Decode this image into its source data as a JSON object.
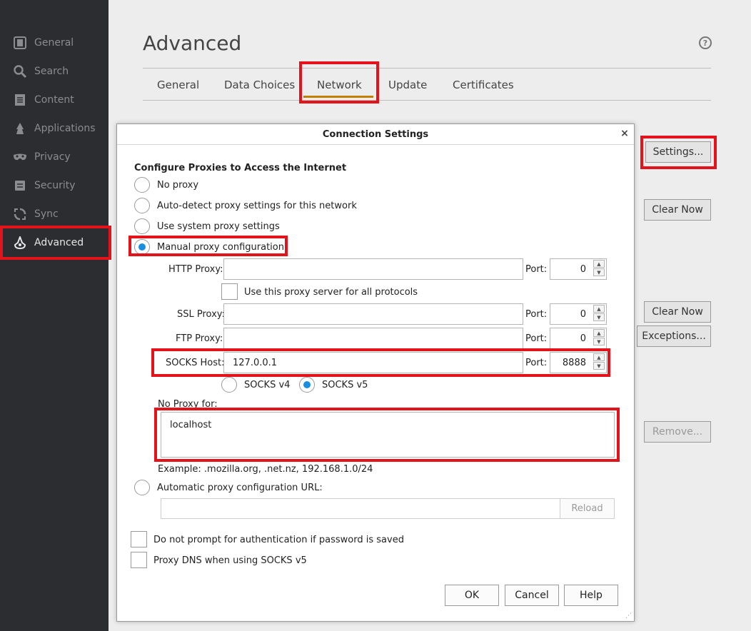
{
  "sidebar": {
    "items": [
      {
        "label": "General",
        "icon": "general-icon"
      },
      {
        "label": "Search",
        "icon": "search-icon"
      },
      {
        "label": "Content",
        "icon": "content-icon"
      },
      {
        "label": "Applications",
        "icon": "applications-icon"
      },
      {
        "label": "Privacy",
        "icon": "privacy-icon"
      },
      {
        "label": "Security",
        "icon": "security-icon"
      },
      {
        "label": "Sync",
        "icon": "sync-icon"
      },
      {
        "label": "Advanced",
        "icon": "advanced-icon",
        "active": true
      }
    ]
  },
  "main": {
    "title": "Advanced",
    "help_icon": "?",
    "tabs": [
      "General",
      "Data Choices",
      "Network",
      "Update",
      "Certificates"
    ],
    "active_tab": "Network",
    "buttons": {
      "settings": "Settings...",
      "clear_now_1": "Clear Now",
      "clear_now_2": "Clear Now",
      "exceptions": "Exceptions...",
      "remove": "Remove..."
    }
  },
  "dialog": {
    "title": "Connection Settings",
    "close": "×",
    "heading": "Configure Proxies to Access the Internet",
    "options": {
      "no_proxy": "No proxy",
      "auto_detect": "Auto-detect proxy settings for this network",
      "system": "Use system proxy settings",
      "manual": "Manual proxy configuration:",
      "auto_url": "Automatic proxy configuration URL:"
    },
    "selected_option": "manual",
    "http_proxy": {
      "label": "HTTP Proxy:",
      "value": "",
      "port_label": "Port:",
      "port": "0"
    },
    "use_for_all": "Use this proxy server for all protocols",
    "ssl_proxy": {
      "label": "SSL Proxy:",
      "value": "",
      "port_label": "Port:",
      "port": "0"
    },
    "ftp_proxy": {
      "label": "FTP Proxy:",
      "value": "",
      "port_label": "Port:",
      "port": "0"
    },
    "socks_host": {
      "label": "SOCKS Host:",
      "value": "127.0.0.1",
      "port_label": "Port:",
      "port": "8888"
    },
    "socks_v4": "SOCKS v4",
    "socks_v5": "SOCKS v5",
    "socks_selected": "v5",
    "no_proxy_for_label": "No Proxy for:",
    "no_proxy_for_value": "localhost",
    "example": "Example: .mozilla.org, .net.nz, 192.168.1.0/24",
    "auto_url_value": "",
    "reload": "Reload",
    "no_prompt_auth": "Do not prompt for authentication if password is saved",
    "proxy_dns": "Proxy DNS when using SOCKS v5",
    "ok": "OK",
    "cancel": "Cancel",
    "help": "Help"
  },
  "colors": {
    "sidebar_bg": "#2b2d30",
    "highlight_red": "#e3121b",
    "radio_selected": "#1a8fe0",
    "tab_underline": "#c28000"
  }
}
